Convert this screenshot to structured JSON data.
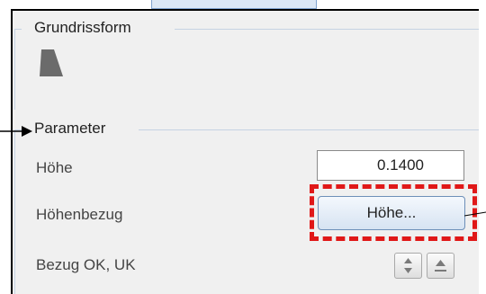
{
  "groups": {
    "floorplan": {
      "title": "Grundrissform",
      "icon": "trapezoid-shape-icon"
    },
    "parameter": {
      "title": "Parameter"
    }
  },
  "fields": {
    "height_label": "Höhe",
    "height_value": "0.1400",
    "height_ref_label": "Höhenbezug",
    "height_ref_button": "Höhe...",
    "ref_label": "Bezug OK, UK"
  },
  "icons": {
    "swap": "up-down-arrows-icon",
    "up": "arrow-up-icon"
  },
  "colors": {
    "highlight": "#e01818",
    "panel_bg": "#f0f0f0",
    "button_border": "#6d8fb8"
  }
}
